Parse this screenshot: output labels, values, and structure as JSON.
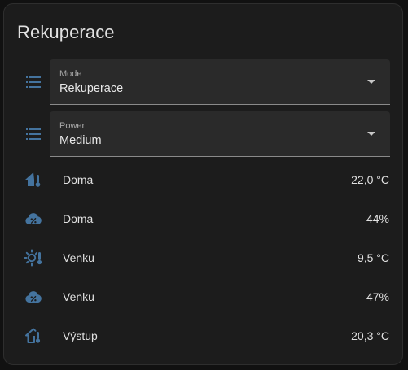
{
  "card": {
    "title": "Rekuperace"
  },
  "selects": [
    {
      "label": "Mode",
      "value": "Rekuperace",
      "icon": "format-list-bulleted-icon"
    },
    {
      "label": "Power",
      "value": "Medium",
      "icon": "format-list-bulleted-icon"
    }
  ],
  "entities": [
    {
      "name": "Doma",
      "value": "22,0 °C",
      "icon": "home-thermometer-icon"
    },
    {
      "name": "Doma",
      "value": "44%",
      "icon": "cloud-percent-icon"
    },
    {
      "name": "Venku",
      "value": "9,5 °C",
      "icon": "sun-thermometer-icon"
    },
    {
      "name": "Venku",
      "value": "47%",
      "icon": "cloud-percent-icon"
    },
    {
      "name": "Výstup",
      "value": "20,3 °C",
      "icon": "home-thermometer-outline-icon"
    }
  ],
  "colors": {
    "icon": "#44739e",
    "background": "#1c1c1c",
    "field": "#2a2a2a"
  }
}
